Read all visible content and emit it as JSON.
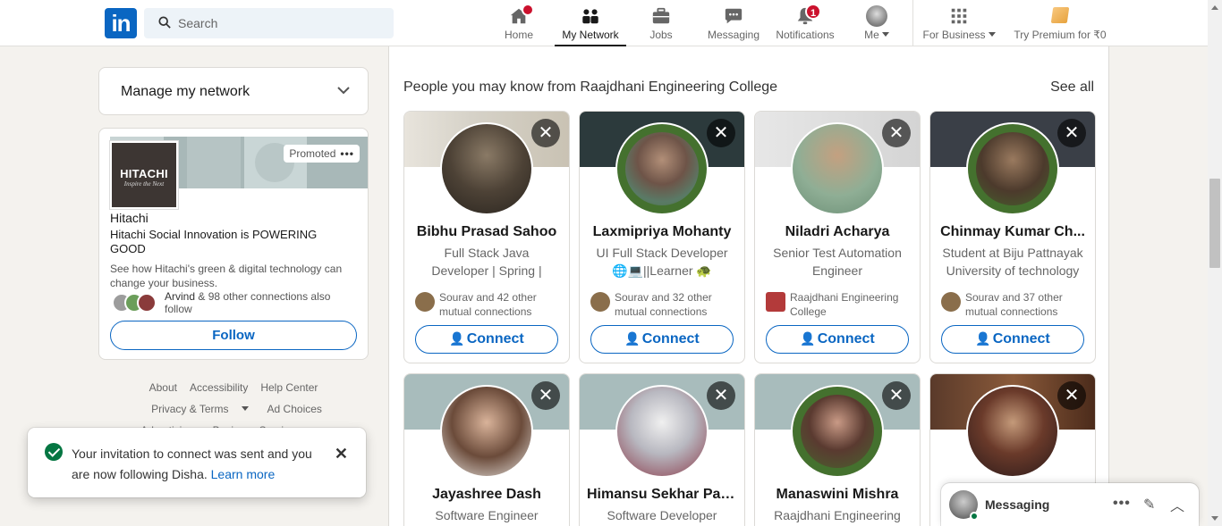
{
  "nav": {
    "search_placeholder": "Search",
    "items": [
      {
        "label": "Home",
        "badge": ""
      },
      {
        "label": "My Network",
        "badge": ""
      },
      {
        "label": "Jobs",
        "badge": ""
      },
      {
        "label": "Messaging",
        "badge": ""
      },
      {
        "label": "Notifications",
        "badge": "1"
      },
      {
        "label": "Me",
        "badge": ""
      },
      {
        "label": "For Business",
        "badge": ""
      },
      {
        "label": "Try Premium for ₹0",
        "badge": ""
      }
    ],
    "logo": "in"
  },
  "sidebar": {
    "manage_title": "Manage my network",
    "ad": {
      "promoted_label": "Promoted",
      "logo_text": "HITACHI",
      "logo_tagline": "Inspire the Next",
      "company": "Hitachi",
      "headline": "Hitachi Social Innovation is POWERING GOOD",
      "description": "See how Hitachi's green & digital technology can change your business.",
      "social_name": "Arvind",
      "social_rest": " & 98 other connections also follow",
      "follow_label": "Follow"
    },
    "footer": {
      "about": "About",
      "accessibility": "Accessibility",
      "help": "Help Center",
      "privacy": "Privacy & Terms",
      "adchoices": "Ad Choices",
      "advertising": "Advertising",
      "business": "Business Services"
    }
  },
  "toast": {
    "message": "Your invitation to connect was sent and you are now following Disha.",
    "link": "Learn more"
  },
  "main": {
    "title": "People you may know from Raajdhani Engineering College",
    "see_all": "See all",
    "connect_label": "Connect",
    "people": [
      {
        "name": "Bibhu Prasad Sahoo",
        "headline": "Full Stack Java Developer | Spring | Spring Boot |...",
        "mutual": "Sourav and 42 other mutual connections"
      },
      {
        "name": "Laxmipriya Mohanty",
        "headline": "UI Full Stack Developer 🌐💻||Learner 🐢",
        "mutual": "Sourav and 32 other mutual connections"
      },
      {
        "name": "Niladri Acharya",
        "headline": "Senior Test Automation Engineer",
        "mutual": "Raajdhani Engineering College"
      },
      {
        "name": "Chinmay Kumar Ch...",
        "headline": "Student at Biju Pattnayak University of technology",
        "mutual": "Sourav and 37 other mutual connections"
      },
      {
        "name": "Jayashree Dash",
        "headline": "Software Engineer",
        "mutual": ""
      },
      {
        "name": "Himansu Sekhar Patra",
        "headline": "Software Developer",
        "mutual": ""
      },
      {
        "name": "Manaswini Mishra",
        "headline": "Raajdhani Engineering",
        "mutual": ""
      },
      {
        "name": "",
        "headline": "",
        "mutual": ""
      }
    ]
  },
  "messaging": {
    "title": "Messaging"
  },
  "colors": {
    "accent": "#0a66c2",
    "badge": "#cb112d",
    "open_to_work": "#44712e",
    "success": "#057642"
  }
}
